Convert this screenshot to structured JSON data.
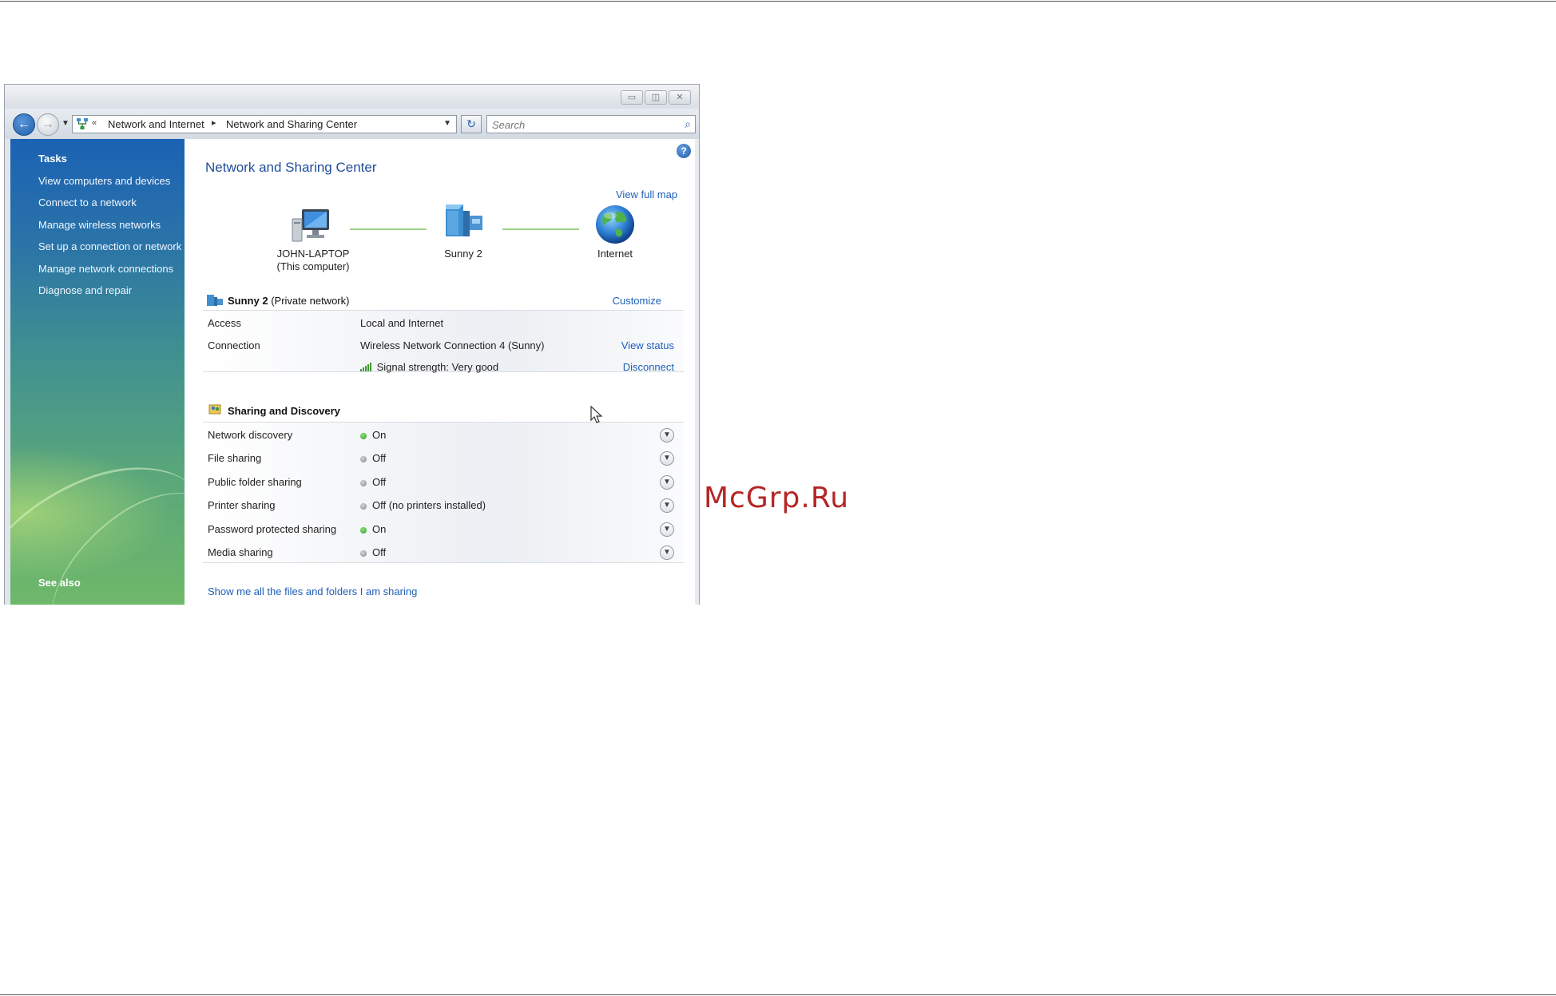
{
  "window": {
    "caption_buttons": {
      "minimize": "▭",
      "maximize": "◫",
      "close": "✕"
    }
  },
  "navigation": {
    "back": "←",
    "forward": "→",
    "breadcrumb_overflow": "«",
    "breadcrumb": [
      "Network and Internet",
      "Network and Sharing Center"
    ],
    "breadcrumb_separator": "▸",
    "refresh": "↻",
    "search_placeholder": "Search"
  },
  "sidebar": {
    "tasks_heading": "Tasks",
    "tasks": [
      "View computers and devices",
      "Connect to a network",
      "Manage wireless networks",
      "Set up a connection or network",
      "Manage network connections",
      "Diagnose and repair"
    ],
    "see_also_heading": "See also"
  },
  "main": {
    "title": "Network and Sharing Center",
    "view_full_map": "View full map",
    "map": {
      "computer_name": "JOHN-LAPTOP",
      "computer_sub": "(This computer)",
      "network_name": "Sunny 2",
      "internet_name": "Internet"
    },
    "network": {
      "name": "Sunny 2",
      "type": "(Private network)",
      "customize": "Customize",
      "access_label": "Access",
      "access_value": "Local and Internet",
      "connection_label": "Connection",
      "connection_value": "Wireless Network Connection 4 (Sunny)",
      "view_status": "View status",
      "signal_label": "Signal strength:",
      "signal_value": "Very good",
      "disconnect": "Disconnect"
    },
    "sharing": {
      "title": "Sharing and Discovery",
      "rows": [
        {
          "label": "Network discovery",
          "status": "On"
        },
        {
          "label": "File sharing",
          "status": "Off"
        },
        {
          "label": "Public folder sharing",
          "status": "Off"
        },
        {
          "label": "Printer sharing",
          "status": "Off (no printers installed)"
        },
        {
          "label": "Password protected sharing",
          "status": "On"
        },
        {
          "label": "Media sharing",
          "status": "Off"
        }
      ],
      "show_files_link": "Show me all the files and folders I am sharing"
    },
    "help": "?"
  },
  "watermark": "McGrp.Ru",
  "colors": {
    "link": "#1f5fb8",
    "title": "#1f4f9a",
    "status_on": "#2f9a2a",
    "status_off": "#7c848c",
    "watermark": "#b42626"
  }
}
